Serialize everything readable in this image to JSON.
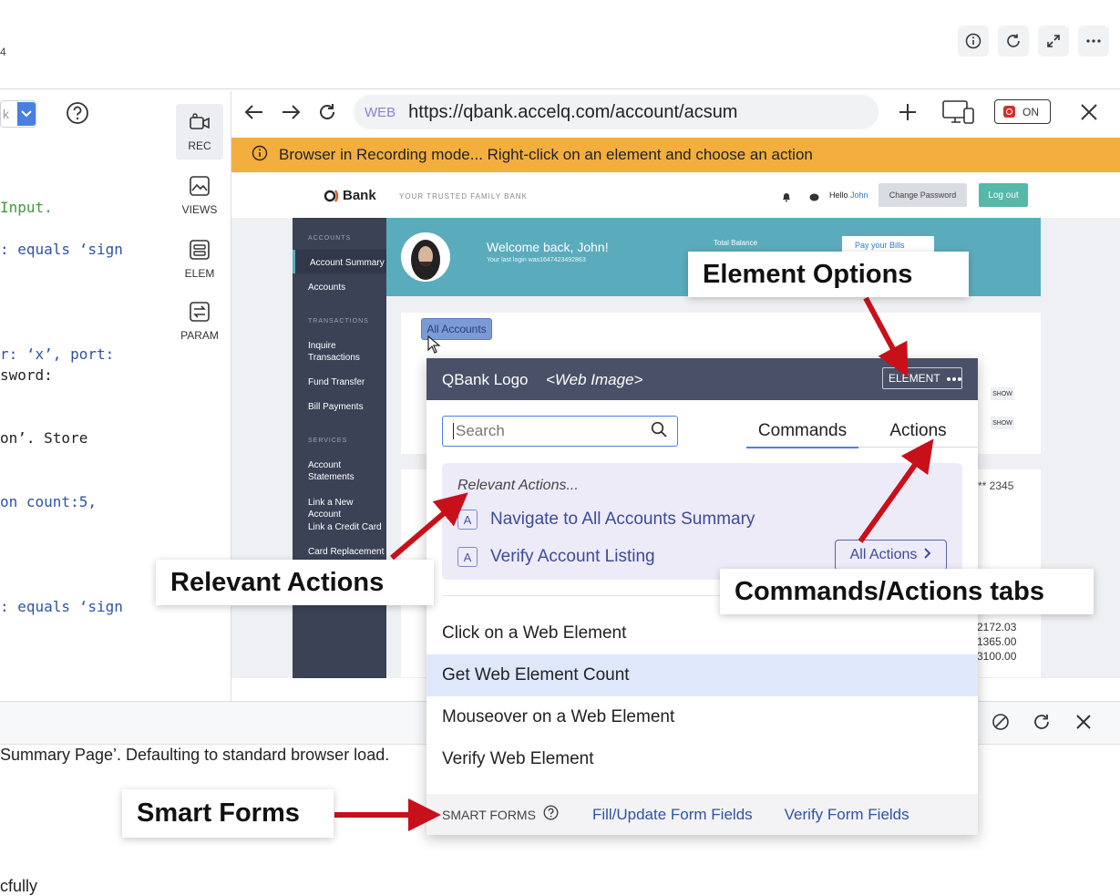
{
  "app": {
    "top_left_fragment": "4"
  },
  "code_editor": {
    "lines": [
      {
        "text": "Input.",
        "color": "green"
      },
      {
        "text": ": equals ‘sign",
        "color": "blue"
      },
      {
        "text": "r: ‘x’, port:",
        "color": "blue"
      },
      {
        "text": "sword:",
        "color": "dark"
      },
      {
        "text": "on’. Store",
        "color": "dark"
      },
      {
        "text": "on count:5,",
        "color": "blue"
      },
      {
        "text": ": equals ‘sign",
        "color": "blue"
      }
    ],
    "select_value": "k"
  },
  "recorder_panel": {
    "items": [
      {
        "label": "REC"
      },
      {
        "label": "VIEWS"
      },
      {
        "label": "ELEM"
      },
      {
        "label": "PARAM"
      }
    ]
  },
  "browser": {
    "url_tag": "WEB",
    "url": "https://qbank.accelq.com/account/acsum",
    "toggle_label": "ON",
    "banner_text": "Browser in Recording mode... Right-click on an element and choose an action"
  },
  "bank_page": {
    "logo": "Bank",
    "tagline": "YOUR TRUSTED FAMILY BANK",
    "hello": "Hello",
    "user": "John",
    "change_password": "Change Password",
    "logout": "Log out",
    "welcome": "Welcome back, John!",
    "last_login": "Your last login was1647423492863",
    "total_balance": "Total Balance",
    "pay_bills": "Pay your Bills",
    "all_accounts_chip": "All Accounts",
    "show_1": "SHOW",
    "show_2": "SHOW",
    "masked_account": "** 2345",
    "amounts": [
      "2172.03",
      "1365.00",
      "3100.00"
    ],
    "sidebar": [
      {
        "text": "ACCOUNTS",
        "type": "section"
      },
      {
        "text": "Account Summary",
        "type": "item"
      },
      {
        "text": "Accounts",
        "type": "item"
      },
      {
        "text": "TRANSACTIONS",
        "type": "section"
      },
      {
        "text": "Inquire Transactions",
        "type": "item"
      },
      {
        "text": "Fund Transfer",
        "type": "item"
      },
      {
        "text": "Bill Payments",
        "type": "item"
      },
      {
        "text": "SERVICES",
        "type": "section"
      },
      {
        "text": "Account Statements",
        "type": "item"
      },
      {
        "text": "Link a New Account",
        "type": "item"
      },
      {
        "text": "Link a Credit Card",
        "type": "item"
      },
      {
        "text": "Card Replacement",
        "type": "item"
      }
    ]
  },
  "popup": {
    "element_name": "QBank Logo",
    "element_type": "<Web Image>",
    "element_button": "ELEMENT",
    "search_placeholder": "Search",
    "tabs": [
      "Commands",
      "Actions"
    ],
    "relevant_heading": "Relevant Actions...",
    "relevant_actions": [
      {
        "key": "A",
        "label": "Navigate to All Accounts Summary"
      },
      {
        "key": "A",
        "label": "Verify Account Listing"
      }
    ],
    "all_actions_button": "All Actions",
    "commands": [
      "Click on a Web Element",
      "Get Web Element Count",
      "Mouseover on a Web Element",
      "Verify Web Element"
    ],
    "highlighted_command_index": 1,
    "smart_forms_label": "SMART FORMS",
    "smart_links": [
      "Fill/Update Form Fields",
      "Verify Form Fields"
    ]
  },
  "log_panel": {
    "line_1": "Summary Page’. Defaulting to standard browser load.",
    "line_2": "cfully"
  },
  "callouts": {
    "element_options": "Element Options",
    "relevant_actions": "Relevant Actions",
    "commands_tabs": "Commands/Actions tabs",
    "smart_forms": "Smart Forms"
  },
  "colors": {
    "accent_blue": "#2e53a8",
    "banner_orange": "#f4ae3e",
    "arrow_red": "#c8101a",
    "popup_header": "#4a5067",
    "relevant_bg": "#eeebf9",
    "highlight_row": "#dfe8fb"
  }
}
